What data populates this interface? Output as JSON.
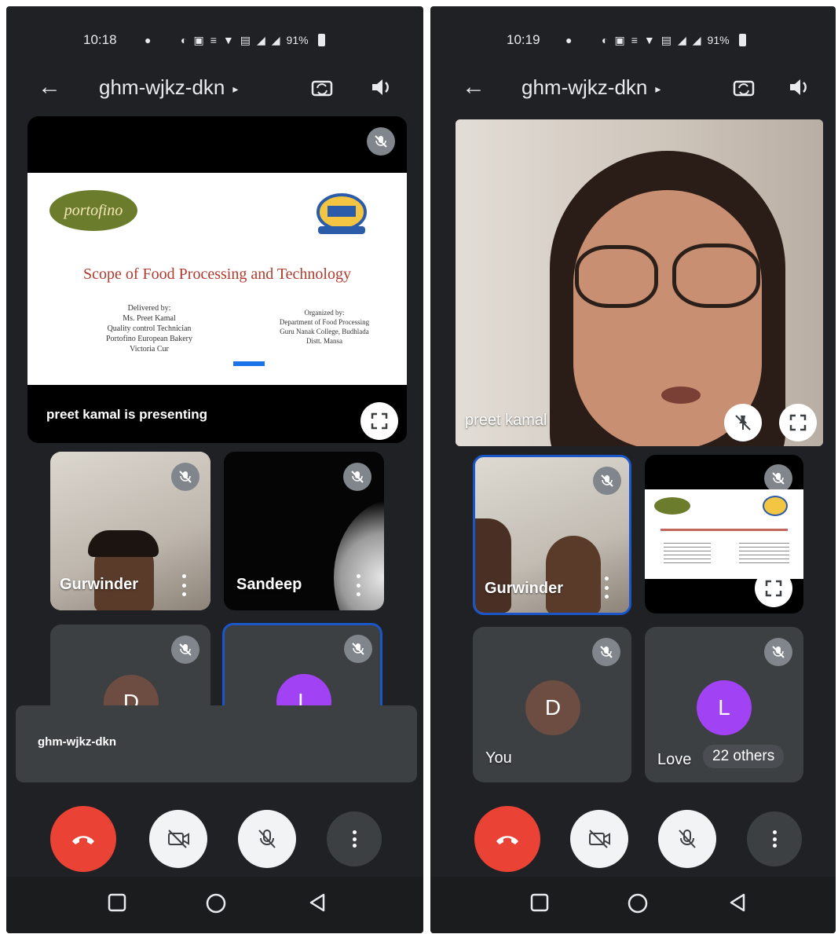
{
  "screens": [
    {
      "status": {
        "time": "10:18",
        "battery": "91%"
      },
      "appbar": {
        "meeting_code": "ghm-wjkz-dkn"
      },
      "presentation": {
        "slide_title": "Scope of Food Processing and Technology",
        "logo_text": "portofino",
        "left_block": [
          "Delivered by:",
          "Ms. Preet Kamal",
          "Quality control Technician",
          "Portofino European Bakery",
          "Victoria Cur"
        ],
        "right_block": [
          "Organized by:",
          "Department of Food Processing",
          "Guru Nanak College, Budhlada",
          "Distt. Mansa"
        ],
        "presenting_label": "preet kamal is presenting"
      },
      "tiles": [
        {
          "name": "Gurwinder"
        },
        {
          "name": "Sandeep"
        },
        {
          "avatar_letter": "D",
          "avatar_color": "#6d4c41"
        },
        {
          "avatar_letter": "L",
          "avatar_color": "#a142f4"
        }
      ],
      "toast": {
        "text": "ghm-wjkz-dkn"
      }
    },
    {
      "status": {
        "time": "10:19",
        "battery": "91%"
      },
      "appbar": {
        "meeting_code": "ghm-wjkz-dkn"
      },
      "speaker": {
        "name": "preet kamal"
      },
      "tiles": [
        {
          "name": "Gurwinder"
        },
        {
          "label": "presentation-thumbnail"
        },
        {
          "avatar_letter": "D",
          "name": "You",
          "avatar_color": "#6d4c41"
        },
        {
          "avatar_letter": "L",
          "name": "Love",
          "avatar_color": "#a142f4",
          "others_chip": "22 others"
        }
      ]
    }
  ],
  "colors": {
    "end_call": "#ea4335",
    "active_border": "#1a56c8",
    "background": "#1f2124"
  }
}
